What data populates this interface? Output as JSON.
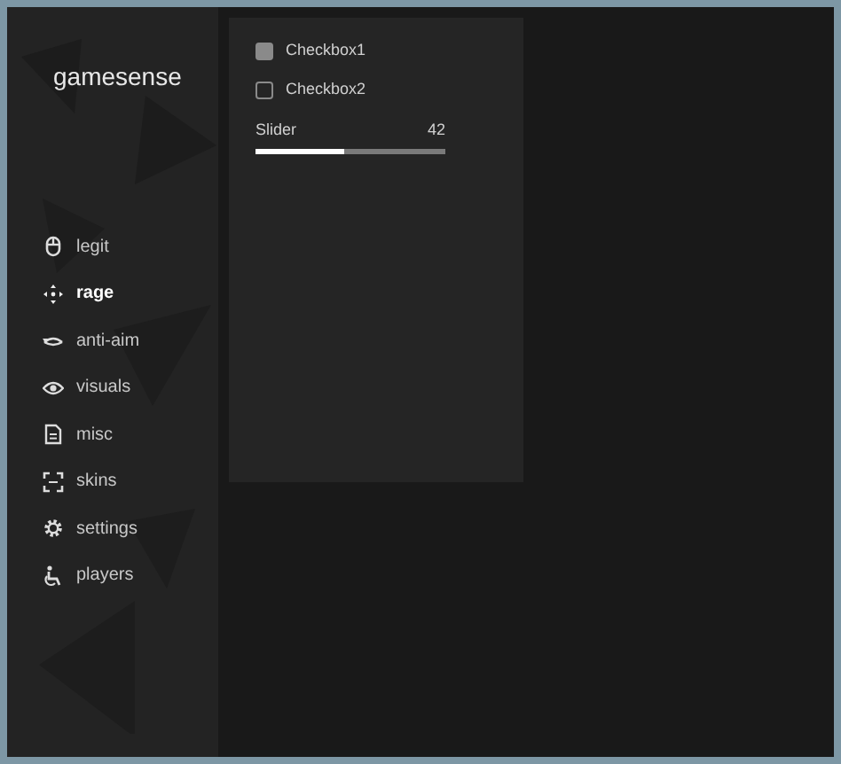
{
  "sidebar": {
    "title": "gamesense",
    "items": [
      {
        "kind": "mouse",
        "label": "legit",
        "selected": false
      },
      {
        "kind": "crosshair",
        "label": "rage",
        "selected": true
      },
      {
        "kind": "antiaim",
        "label": "anti-aim",
        "selected": false
      },
      {
        "kind": "eye",
        "label": "visuals",
        "selected": false
      },
      {
        "kind": "doc",
        "label": "misc",
        "selected": false
      },
      {
        "kind": "scan",
        "label": "skins",
        "selected": false
      },
      {
        "kind": "gear",
        "label": "settings",
        "selected": false
      },
      {
        "kind": "person",
        "label": "players",
        "selected": false
      }
    ]
  },
  "panel": {
    "controls": [
      {
        "kind": "checkbox",
        "label": "Checkbox1",
        "checked": true
      },
      {
        "kind": "checkbox",
        "label": "Checkbox2",
        "checked": false
      },
      {
        "kind": "slider",
        "label": "Slider",
        "reading": "42",
        "level": 0.47
      }
    ]
  }
}
